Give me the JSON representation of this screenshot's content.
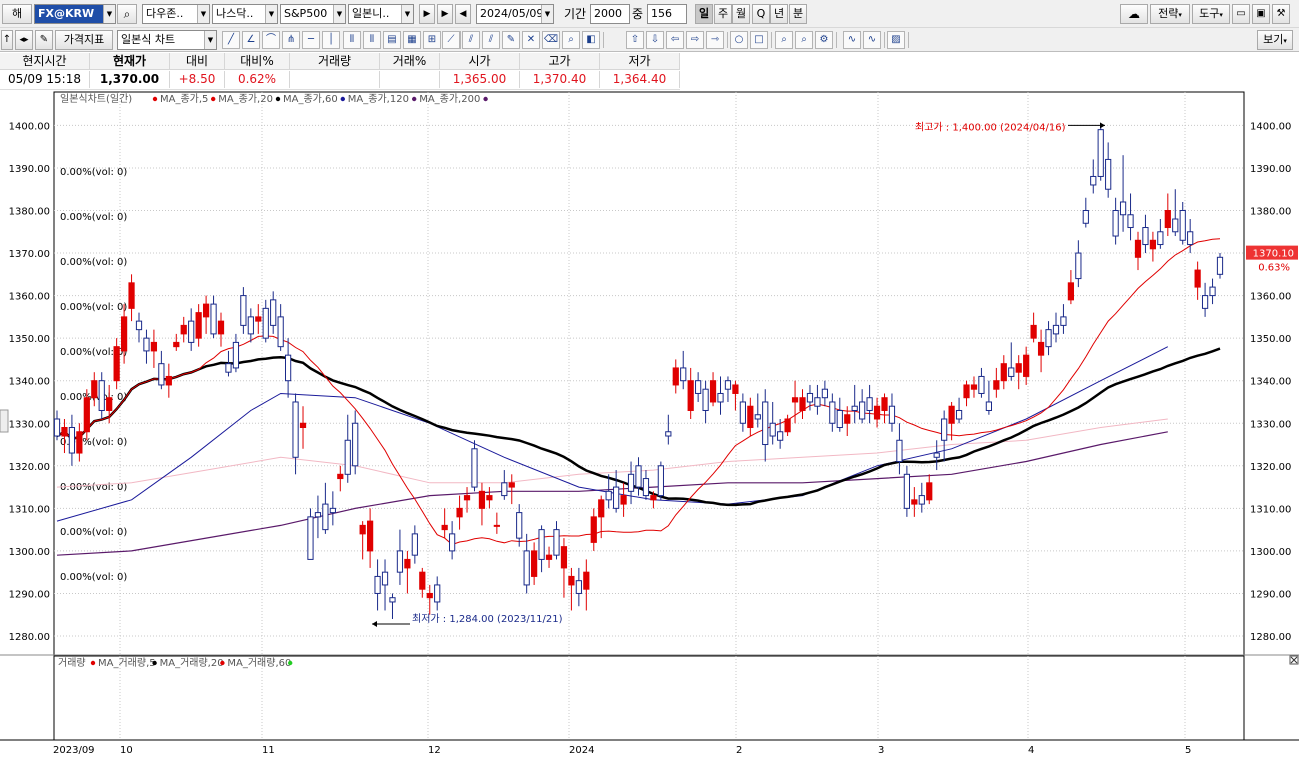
{
  "toolbar": {
    "market_label": "해",
    "symbol_code": "FX@KRW",
    "search_icon": "magnifier-icon",
    "exchange": "다우존..",
    "index_exchange": "나스닥..",
    "index": "S&P500",
    "chart_kind": "일본니..",
    "date": "2024/05/09",
    "period_label": "기간",
    "period_value": "2000",
    "middle_label": "중",
    "middle_value": "156",
    "intervals": [
      "일",
      "주",
      "월",
      "Q",
      "년",
      "분"
    ],
    "active_interval": "일",
    "strategy": "전략",
    "tools": "도구",
    "indicator_button": "가격지표",
    "chart_type": "일본식 차트",
    "view_button": "보기"
  },
  "quote": {
    "headers": [
      "현지시간",
      "현재가",
      "대비",
      "대비%",
      "거래량",
      "거래%",
      "시가",
      "고가",
      "저가"
    ],
    "values": [
      "05/09   15:18",
      "1,370.00",
      "+8.50",
      "0.62%",
      "",
      "",
      "1,365.00",
      "1,370.40",
      "1,364.40"
    ]
  },
  "legend": {
    "price_title": "일본식차트(일간)",
    "price_items": [
      {
        "label": "MA_종가,5",
        "color": "#e00000"
      },
      {
        "label": "MA_종가,20",
        "color": "#e00000"
      },
      {
        "label": "MA_종가,60",
        "color": "#000000"
      },
      {
        "label": "MA_종가,120",
        "color": "#1a1a9a"
      },
      {
        "label": "MA_종가,200",
        "color": "#5a1a6a"
      }
    ],
    "volume_title": "거래량",
    "volume_items": [
      {
        "label": "MA_거래량,5",
        "color": "#e00000"
      },
      {
        "label": "MA_거래량,20",
        "color": "#000000"
      },
      {
        "label": "MA_거래량,60",
        "color": "#e00000"
      },
      {
        "label": "",
        "color": "#22cc22"
      }
    ]
  },
  "chart_data": {
    "type": "candlestick",
    "y_range": [
      1276,
      1404
    ],
    "y_ticks": [
      "1400.00",
      "1390.00",
      "1380.00",
      "1370.00",
      "1360.00",
      "1350.00",
      "1340.00",
      "1330.00",
      "1320.00",
      "1310.00",
      "1300.00",
      "1290.00",
      "1280.00"
    ],
    "x_labels": [
      "2023/09",
      "10",
      "11",
      "12",
      "2024",
      "2",
      "3",
      "4",
      "5"
    ],
    "pct_labels": [
      "0.00%(vol: 0)",
      "0.00%(vol: 0)",
      "0.00%(vol: 0)",
      "0.00%(vol: 0)",
      "0.00%(vol: 0)",
      "0.00%(vol: 0)",
      "0.00%(vol: 0)",
      "0.00%(vol: 0)",
      "0.00%(vol: 0)",
      "0.00%(vol: 0)"
    ],
    "last_price": "1370.10",
    "last_change": "0.63%",
    "high_annotation": "최고가 : 1,400.00 (2024/04/16)",
    "low_annotation": "최저가 : 1,284.00 (2023/11/21)",
    "candles": [
      {
        "o": 1331,
        "h": 1333,
        "l": 1326,
        "c": 1327
      },
      {
        "o": 1327,
        "h": 1331,
        "l": 1323,
        "c": 1329
      },
      {
        "o": 1329,
        "h": 1332,
        "l": 1320,
        "c": 1323
      },
      {
        "o": 1323,
        "h": 1330,
        "l": 1321,
        "c": 1328
      },
      {
        "o": 1328,
        "h": 1338,
        "l": 1326,
        "c": 1336
      },
      {
        "o": 1336,
        "h": 1342,
        "l": 1334,
        "c": 1340
      },
      {
        "o": 1340,
        "h": 1342,
        "l": 1331,
        "c": 1333
      },
      {
        "o": 1333,
        "h": 1339,
        "l": 1330,
        "c": 1336
      },
      {
        "o": 1340,
        "h": 1350,
        "l": 1338,
        "c": 1348
      },
      {
        "o": 1347,
        "h": 1358,
        "l": 1344,
        "c": 1355
      },
      {
        "o": 1357,
        "h": 1365,
        "l": 1354,
        "c": 1363
      },
      {
        "o": 1354,
        "h": 1356,
        "l": 1349,
        "c": 1352
      },
      {
        "o": 1350,
        "h": 1352,
        "l": 1344,
        "c": 1347
      },
      {
        "o": 1347,
        "h": 1352,
        "l": 1343,
        "c": 1349
      },
      {
        "o": 1344,
        "h": 1347,
        "l": 1338,
        "c": 1339
      },
      {
        "o": 1339,
        "h": 1344,
        "l": 1336,
        "c": 1341
      },
      {
        "o": 1348,
        "h": 1351,
        "l": 1347,
        "c": 1349
      },
      {
        "o": 1351,
        "h": 1355,
        "l": 1349,
        "c": 1353
      },
      {
        "o": 1354,
        "h": 1357,
        "l": 1347,
        "c": 1349
      },
      {
        "o": 1350,
        "h": 1358,
        "l": 1348,
        "c": 1356
      },
      {
        "o": 1355,
        "h": 1360,
        "l": 1351,
        "c": 1358
      },
      {
        "o": 1358,
        "h": 1360,
        "l": 1350,
        "c": 1351
      },
      {
        "o": 1351,
        "h": 1356,
        "l": 1348,
        "c": 1354
      },
      {
        "o": 1344,
        "h": 1347,
        "l": 1341,
        "c": 1342
      },
      {
        "o": 1349,
        "h": 1351,
        "l": 1342,
        "c": 1343
      },
      {
        "o": 1360,
        "h": 1362,
        "l": 1351,
        "c": 1353
      },
      {
        "o": 1355,
        "h": 1357,
        "l": 1349,
        "c": 1351
      },
      {
        "o": 1354,
        "h": 1358,
        "l": 1351,
        "c": 1355
      },
      {
        "o": 1357,
        "h": 1359,
        "l": 1349,
        "c": 1350
      },
      {
        "o": 1359,
        "h": 1361,
        "l": 1351,
        "c": 1353
      },
      {
        "o": 1355,
        "h": 1358,
        "l": 1347,
        "c": 1348
      },
      {
        "o": 1346,
        "h": 1350,
        "l": 1336,
        "c": 1340
      },
      {
        "o": 1335,
        "h": 1337,
        "l": 1318,
        "c": 1322
      },
      {
        "o": 1329,
        "h": 1334,
        "l": 1324,
        "c": 1330
      },
      {
        "o": 1308,
        "h": 1310,
        "l": 1298,
        "c": 1298
      },
      {
        "o": 1309,
        "h": 1313,
        "l": 1303,
        "c": 1308
      },
      {
        "o": 1311,
        "h": 1316,
        "l": 1304,
        "c": 1305
      },
      {
        "o": 1310,
        "h": 1314,
        "l": 1306,
        "c": 1309
      },
      {
        "o": 1317,
        "h": 1320,
        "l": 1314,
        "c": 1318
      },
      {
        "o": 1326,
        "h": 1332,
        "l": 1316,
        "c": 1318
      },
      {
        "o": 1330,
        "h": 1333,
        "l": 1318,
        "c": 1320
      },
      {
        "o": 1304,
        "h": 1307,
        "l": 1298,
        "c": 1306
      },
      {
        "o": 1300,
        "h": 1310,
        "l": 1296,
        "c": 1307
      },
      {
        "o": 1294,
        "h": 1298,
        "l": 1286,
        "c": 1290
      },
      {
        "o": 1295,
        "h": 1298,
        "l": 1286,
        "c": 1292
      },
      {
        "o": 1289,
        "h": 1290,
        "l": 1284,
        "c": 1288
      },
      {
        "o": 1300,
        "h": 1305,
        "l": 1292,
        "c": 1295
      },
      {
        "o": 1296,
        "h": 1300,
        "l": 1290,
        "c": 1298
      },
      {
        "o": 1304,
        "h": 1306,
        "l": 1297,
        "c": 1299
      },
      {
        "o": 1291,
        "h": 1296,
        "l": 1289,
        "c": 1295
      },
      {
        "o": 1289,
        "h": 1292,
        "l": 1285,
        "c": 1290
      },
      {
        "o": 1292,
        "h": 1294,
        "l": 1286,
        "c": 1288
      },
      {
        "o": 1305,
        "h": 1310,
        "l": 1303,
        "c": 1306
      },
      {
        "o": 1304,
        "h": 1307,
        "l": 1298,
        "c": 1300
      },
      {
        "o": 1308,
        "h": 1313,
        "l": 1305,
        "c": 1310
      },
      {
        "o": 1312,
        "h": 1315,
        "l": 1309,
        "c": 1313
      },
      {
        "o": 1324,
        "h": 1326,
        "l": 1314,
        "c": 1315
      },
      {
        "o": 1310,
        "h": 1316,
        "l": 1306,
        "c": 1314
      },
      {
        "o": 1312,
        "h": 1315,
        "l": 1310,
        "c": 1313
      },
      {
        "o": 1306,
        "h": 1309,
        "l": 1304,
        "c": 1306
      },
      {
        "o": 1316,
        "h": 1319,
        "l": 1312,
        "c": 1313
      },
      {
        "o": 1315,
        "h": 1318,
        "l": 1311,
        "c": 1316
      },
      {
        "o": 1309,
        "h": 1311,
        "l": 1301,
        "c": 1303
      },
      {
        "o": 1300,
        "h": 1304,
        "l": 1290,
        "c": 1292
      },
      {
        "o": 1294,
        "h": 1302,
        "l": 1292,
        "c": 1300
      },
      {
        "o": 1305,
        "h": 1306,
        "l": 1295,
        "c": 1298
      },
      {
        "o": 1298,
        "h": 1301,
        "l": 1296,
        "c": 1299
      },
      {
        "o": 1305,
        "h": 1307,
        "l": 1298,
        "c": 1299
      },
      {
        "o": 1296,
        "h": 1303,
        "l": 1289,
        "c": 1301
      },
      {
        "o": 1292,
        "h": 1296,
        "l": 1286,
        "c": 1294
      },
      {
        "o": 1293,
        "h": 1296,
        "l": 1287,
        "c": 1290
      },
      {
        "o": 1291,
        "h": 1298,
        "l": 1286,
        "c": 1295
      },
      {
        "o": 1302,
        "h": 1310,
        "l": 1300,
        "c": 1308
      },
      {
        "o": 1308,
        "h": 1313,
        "l": 1303,
        "c": 1312
      },
      {
        "o": 1314,
        "h": 1318,
        "l": 1310,
        "c": 1312
      },
      {
        "o": 1315,
        "h": 1319,
        "l": 1309,
        "c": 1310
      },
      {
        "o": 1311,
        "h": 1316,
        "l": 1308,
        "c": 1313
      },
      {
        "o": 1318,
        "h": 1321,
        "l": 1311,
        "c": 1314
      },
      {
        "o": 1320,
        "h": 1322,
        "l": 1313,
        "c": 1315
      },
      {
        "o": 1317,
        "h": 1319,
        "l": 1312,
        "c": 1313
      },
      {
        "o": 1312,
        "h": 1314,
        "l": 1310,
        "c": 1313
      },
      {
        "o": 1320,
        "h": 1321,
        "l": 1312,
        "c": 1313
      },
      {
        "o": 1328,
        "h": 1332,
        "l": 1325,
        "c": 1327
      },
      {
        "o": 1339,
        "h": 1345,
        "l": 1337,
        "c": 1343
      },
      {
        "o": 1343,
        "h": 1347,
        "l": 1338,
        "c": 1340
      },
      {
        "o": 1333,
        "h": 1343,
        "l": 1331,
        "c": 1340
      },
      {
        "o": 1340,
        "h": 1342,
        "l": 1335,
        "c": 1337
      },
      {
        "o": 1338,
        "h": 1340,
        "l": 1330,
        "c": 1333
      },
      {
        "o": 1335,
        "h": 1342,
        "l": 1334,
        "c": 1340
      },
      {
        "o": 1337,
        "h": 1341,
        "l": 1332,
        "c": 1335
      },
      {
        "o": 1340,
        "h": 1341,
        "l": 1335,
        "c": 1338
      },
      {
        "o": 1337,
        "h": 1340,
        "l": 1333,
        "c": 1339
      },
      {
        "o": 1335,
        "h": 1337,
        "l": 1328,
        "c": 1330
      },
      {
        "o": 1329,
        "h": 1336,
        "l": 1327,
        "c": 1334
      },
      {
        "o": 1332,
        "h": 1337,
        "l": 1329,
        "c": 1331
      },
      {
        "o": 1335,
        "h": 1338,
        "l": 1321,
        "c": 1325
      },
      {
        "o": 1330,
        "h": 1335,
        "l": 1325,
        "c": 1327
      },
      {
        "o": 1328,
        "h": 1331,
        "l": 1324,
        "c": 1326
      },
      {
        "o": 1328,
        "h": 1332,
        "l": 1327,
        "c": 1331
      },
      {
        "o": 1335,
        "h": 1340,
        "l": 1330,
        "c": 1336
      },
      {
        "o": 1333,
        "h": 1338,
        "l": 1331,
        "c": 1336
      },
      {
        "o": 1337,
        "h": 1339,
        "l": 1333,
        "c": 1335
      },
      {
        "o": 1336,
        "h": 1339,
        "l": 1332,
        "c": 1334
      },
      {
        "o": 1338,
        "h": 1340,
        "l": 1334,
        "c": 1336
      },
      {
        "o": 1335,
        "h": 1337,
        "l": 1328,
        "c": 1330
      },
      {
        "o": 1333,
        "h": 1336,
        "l": 1328,
        "c": 1329
      },
      {
        "o": 1330,
        "h": 1334,
        "l": 1327,
        "c": 1332
      },
      {
        "o": 1334,
        "h": 1339,
        "l": 1330,
        "c": 1333
      },
      {
        "o": 1335,
        "h": 1338,
        "l": 1330,
        "c": 1331
      },
      {
        "o": 1336,
        "h": 1339,
        "l": 1330,
        "c": 1333
      },
      {
        "o": 1331,
        "h": 1336,
        "l": 1329,
        "c": 1334
      },
      {
        "o": 1333,
        "h": 1337,
        "l": 1330,
        "c": 1336
      },
      {
        "o": 1334,
        "h": 1337,
        "l": 1328,
        "c": 1330
      },
      {
        "o": 1326,
        "h": 1330,
        "l": 1318,
        "c": 1321
      },
      {
        "o": 1318,
        "h": 1320,
        "l": 1308,
        "c": 1310
      },
      {
        "o": 1311,
        "h": 1315,
        "l": 1308,
        "c": 1312
      },
      {
        "o": 1313,
        "h": 1316,
        "l": 1309,
        "c": 1311
      },
      {
        "o": 1312,
        "h": 1318,
        "l": 1311,
        "c": 1316
      },
      {
        "o": 1323,
        "h": 1326,
        "l": 1319,
        "c": 1322
      },
      {
        "o": 1331,
        "h": 1333,
        "l": 1321,
        "c": 1326
      },
      {
        "o": 1330,
        "h": 1335,
        "l": 1326,
        "c": 1334
      },
      {
        "o": 1333,
        "h": 1336,
        "l": 1330,
        "c": 1331
      },
      {
        "o": 1336,
        "h": 1340,
        "l": 1334,
        "c": 1339
      },
      {
        "o": 1338,
        "h": 1341,
        "l": 1336,
        "c": 1339
      },
      {
        "o": 1341,
        "h": 1343,
        "l": 1336,
        "c": 1337
      },
      {
        "o": 1335,
        "h": 1340,
        "l": 1332,
        "c": 1333
      },
      {
        "o": 1338,
        "h": 1343,
        "l": 1336,
        "c": 1340
      },
      {
        "o": 1340,
        "h": 1346,
        "l": 1338,
        "c": 1344
      },
      {
        "o": 1343,
        "h": 1349,
        "l": 1340,
        "c": 1341
      },
      {
        "o": 1342,
        "h": 1346,
        "l": 1338,
        "c": 1344
      },
      {
        "o": 1341,
        "h": 1348,
        "l": 1339,
        "c": 1346
      },
      {
        "o": 1350,
        "h": 1356,
        "l": 1349,
        "c": 1353
      },
      {
        "o": 1346,
        "h": 1352,
        "l": 1342,
        "c": 1349
      },
      {
        "o": 1352,
        "h": 1354,
        "l": 1346,
        "c": 1348
      },
      {
        "o": 1353,
        "h": 1356,
        "l": 1349,
        "c": 1351
      },
      {
        "o": 1355,
        "h": 1358,
        "l": 1351,
        "c": 1353
      },
      {
        "o": 1359,
        "h": 1366,
        "l": 1358,
        "c": 1363
      },
      {
        "o": 1370,
        "h": 1373,
        "l": 1362,
        "c": 1364
      },
      {
        "o": 1380,
        "h": 1383,
        "l": 1376,
        "c": 1377
      },
      {
        "o": 1388,
        "h": 1392,
        "l": 1384,
        "c": 1386
      },
      {
        "o": 1399,
        "h": 1400,
        "l": 1387,
        "c": 1388
      },
      {
        "o": 1392,
        "h": 1396,
        "l": 1383,
        "c": 1385
      },
      {
        "o": 1380,
        "h": 1383,
        "l": 1372,
        "c": 1374
      },
      {
        "o": 1382,
        "h": 1393,
        "l": 1375,
        "c": 1379
      },
      {
        "o": 1379,
        "h": 1384,
        "l": 1373,
        "c": 1376
      },
      {
        "o": 1369,
        "h": 1375,
        "l": 1366,
        "c": 1373
      },
      {
        "o": 1376,
        "h": 1379,
        "l": 1370,
        "c": 1372
      },
      {
        "o": 1371,
        "h": 1375,
        "l": 1368,
        "c": 1373
      },
      {
        "o": 1375,
        "h": 1378,
        "l": 1371,
        "c": 1372
      },
      {
        "o": 1376,
        "h": 1384,
        "l": 1374,
        "c": 1380
      },
      {
        "o": 1378,
        "h": 1385,
        "l": 1374,
        "c": 1375
      },
      {
        "o": 1380,
        "h": 1382,
        "l": 1372,
        "c": 1373
      },
      {
        "o": 1375,
        "h": 1378,
        "l": 1370,
        "c": 1372
      },
      {
        "o": 1362,
        "h": 1368,
        "l": 1359,
        "c": 1366
      },
      {
        "o": 1360,
        "h": 1363,
        "l": 1355,
        "c": 1357
      },
      {
        "o": 1362,
        "h": 1364,
        "l": 1358,
        "c": 1360
      },
      {
        "o": 1369,
        "h": 1370,
        "l": 1364,
        "c": 1365
      }
    ]
  }
}
